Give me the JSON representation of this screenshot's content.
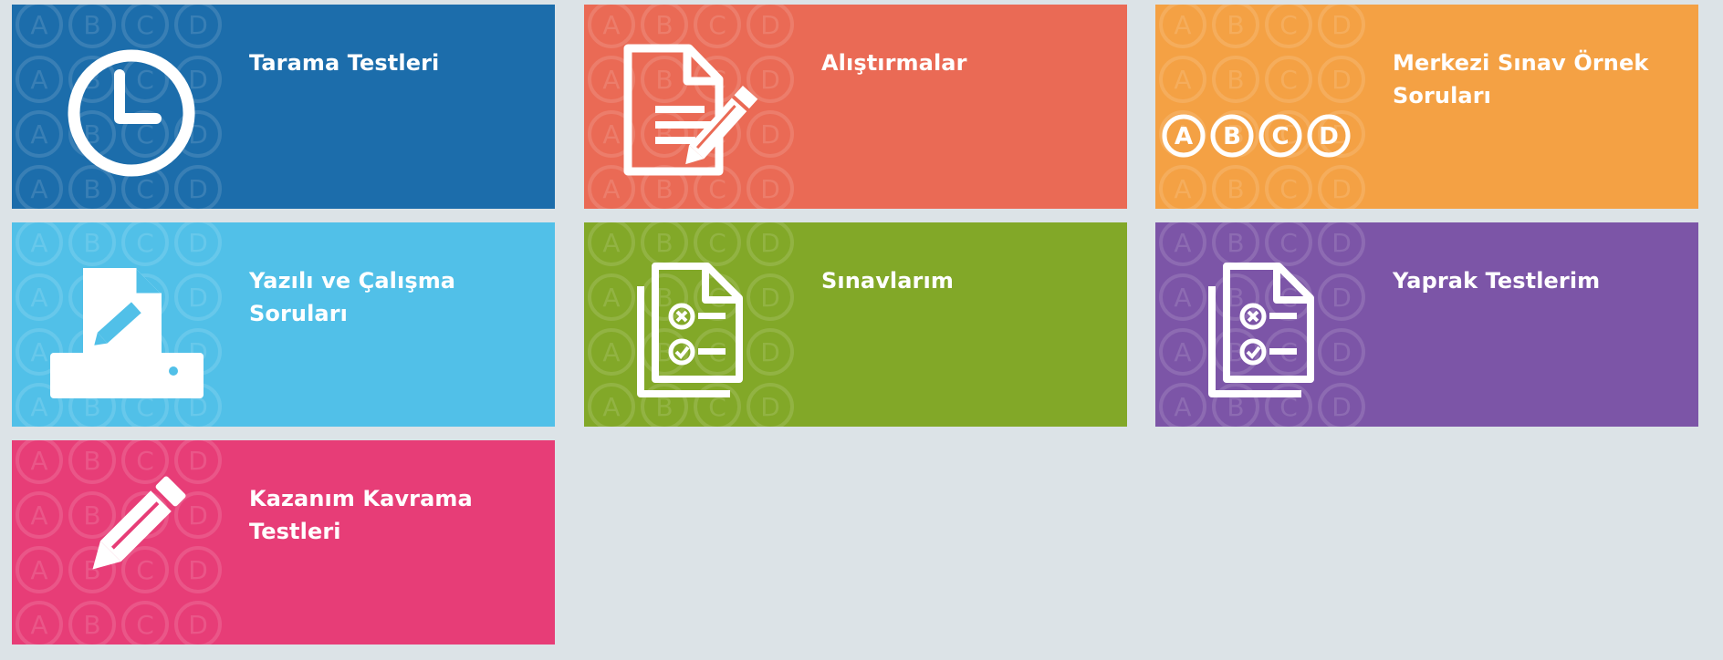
{
  "tiles": [
    {
      "label": "Tarama Testleri",
      "color": "#1c6dab",
      "icon": "clock-icon"
    },
    {
      "label": "Alıştırmalar",
      "color": "#ea6a55",
      "icon": "document-edit-icon"
    },
    {
      "label": "Merkezi Sınav Örnek Soruları",
      "color": "#f4a144",
      "icon": "abcd-options-icon"
    },
    {
      "label": "Yazılı ve Çalışma Soruları",
      "color": "#51c0e8",
      "icon": "printer-document-icon"
    },
    {
      "label": "Sınavlarım",
      "color": "#82a828",
      "icon": "checklist-documents-icon"
    },
    {
      "label": "Yaprak Testlerim",
      "color": "#7c55a7",
      "icon": "checklist-documents-icon"
    },
    {
      "label": "Kazanım Kavrama Testleri",
      "color": "#e73d77",
      "icon": "pencil-icon"
    }
  ],
  "pattern_letters": [
    "A",
    "B",
    "C",
    "D"
  ]
}
